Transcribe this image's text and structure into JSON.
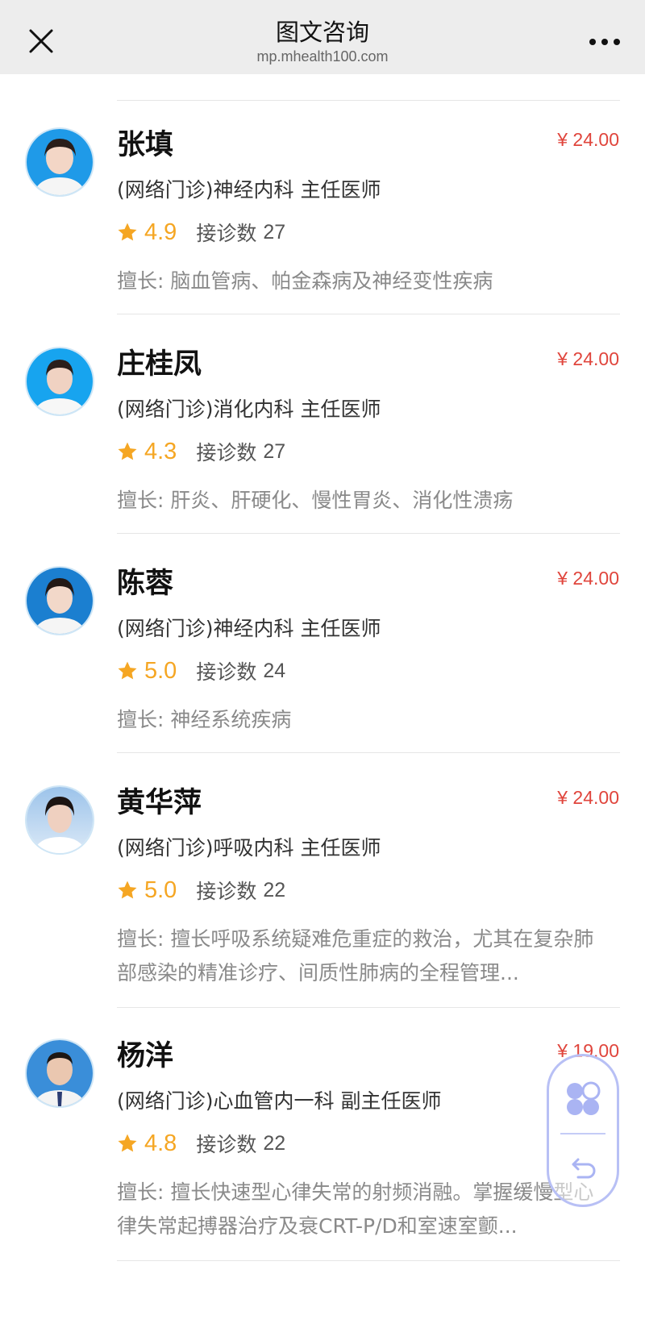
{
  "header": {
    "title": "图文咨询",
    "subtitle": "mp.mhealth100.com"
  },
  "doctors": [
    {
      "name": "张填",
      "price": "¥ 24.00",
      "dept": "(网络门诊)神经内科  主任医师",
      "score": "4.9",
      "visits_label": "接诊数",
      "visits": "27",
      "skill": "擅长: 脑血管病、帕金森病及神经变性疾病"
    },
    {
      "name": "庄桂凤",
      "price": "¥ 24.00",
      "dept": "(网络门诊)消化内科  主任医师",
      "score": "4.3",
      "visits_label": "接诊数",
      "visits": "27",
      "skill": "擅长: 肝炎、肝硬化、慢性胃炎、消化性溃疡"
    },
    {
      "name": "陈蓉",
      "price": "¥ 24.00",
      "dept": "(网络门诊)神经内科  主任医师",
      "score": "5.0",
      "visits_label": "接诊数",
      "visits": "24",
      "skill": "擅长: 神经系统疾病"
    },
    {
      "name": "黄华萍",
      "price": "¥ 24.00",
      "dept": "(网络门诊)呼吸内科  主任医师",
      "score": "5.0",
      "visits_label": "接诊数",
      "visits": "22",
      "skill": "擅长: 擅长呼吸系统疑难危重症的救治，尤其在复杂肺部感染的精准诊疗、间质性肺病的全程管理..."
    },
    {
      "name": "杨洋",
      "price": "¥ 19.00",
      "dept": "(网络门诊)心血管内一科  副主任医师",
      "score": "4.8",
      "visits_label": "接诊数",
      "visits": "22",
      "skill": "擅长: 擅长快速型心律失常的射频消融。掌握缓慢型心律失常起搏器治疗及衰CRT-P/D和室速室颤..."
    }
  ],
  "colors": {
    "price": "#e0453c",
    "score": "#f5a623",
    "header_bg": "#ededed"
  },
  "icons": {
    "close": "close-icon",
    "more": "more-icon",
    "star": "star-icon",
    "apps": "mini-program-icon",
    "back": "back-icon"
  }
}
